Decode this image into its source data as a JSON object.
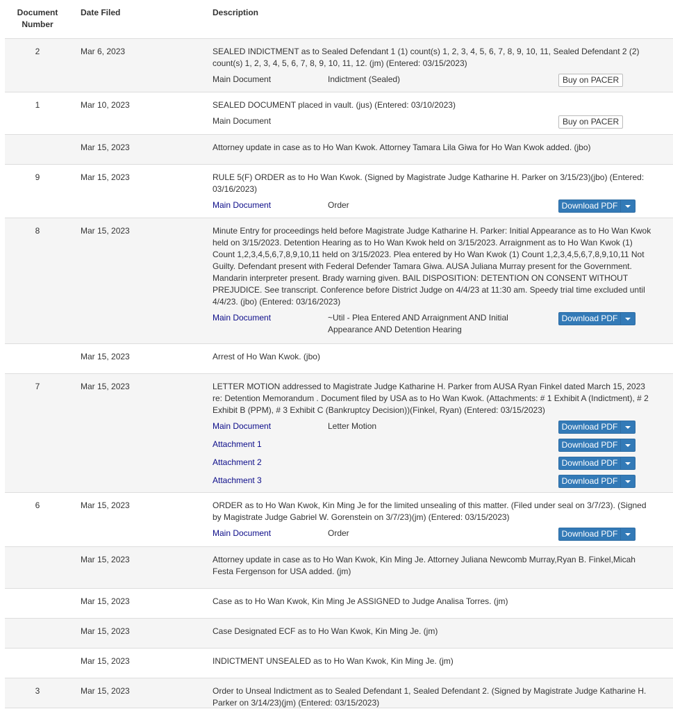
{
  "headers": {
    "number": "Document Number",
    "date": "Date Filed",
    "description": "Description"
  },
  "entries": [
    {
      "number": "2",
      "date": "Mar 6, 2023",
      "description": "SEALED INDICTMENT as to Sealed Defendant 1 (1) count(s) 1, 2, 3, 4, 5, 6, 7, 8, 9, 10, 11, Sealed Defendant 2 (2) count(s) 1, 2, 3, 4, 5, 6, 7, 8, 9, 10, 11, 12. (jm) (Entered: 03/15/2023)",
      "attachments": [
        {
          "label": "Main Document",
          "desc": "Indictment (Sealed)",
          "action": "Buy on PACER",
          "link": false
        }
      ]
    },
    {
      "number": "1",
      "date": "Mar 10, 2023",
      "description": "SEALED DOCUMENT placed in vault. (jus) (Entered: 03/10/2023)",
      "attachments": [
        {
          "label": "Main Document",
          "desc": "",
          "action": "Buy on PACER",
          "link": false
        }
      ]
    },
    {
      "number": "",
      "date": "Mar 15, 2023",
      "description": "Attorney update in case as to Ho Wan Kwok. Attorney Tamara Lila Giwa for Ho Wan Kwok added. (jbo)",
      "attachments": []
    },
    {
      "number": "9",
      "date": "Mar 15, 2023",
      "description": "RULE 5(F) ORDER as to Ho Wan Kwok. (Signed by Magistrate Judge Katharine H. Parker on 3/15/23)(jbo) (Entered: 03/16/2023)",
      "attachments": [
        {
          "label": "Main Document",
          "desc": "Order",
          "action": "Download PDF",
          "link": true
        }
      ]
    },
    {
      "number": "8",
      "date": "Mar 15, 2023",
      "description": "Minute Entry for proceedings held before Magistrate Judge Katharine H. Parker: Initial Appearance as to Ho Wan Kwok held on 3/15/2023. Detention Hearing as to Ho Wan Kwok held on 3/15/2023. Arraignment as to Ho Wan Kwok (1) Count 1,2,3,4,5,6,7,8,9,10,11 held on 3/15/2023. Plea entered by Ho Wan Kwok (1) Count 1,2,3,4,5,6,7,8,9,10,11 Not Guilty. Defendant present with Federal Defender Tamara Giwa. AUSA Juliana Murray present for the Government. Mandarin interpreter present. Brady warning given. BAIL DISPOSITION: DETENTION ON CONSENT WITHOUT PREJUDICE. See transcript. Conference before District Judge on 4/4/23 at 11:30 am. Speedy trial time excluded until 4/4/23. (jbo) (Entered: 03/16/2023)",
      "attachments": [
        {
          "label": "Main Document",
          "desc": "~Util - Plea Entered AND Arraignment AND Initial Appearance AND Detention Hearing",
          "action": "Download PDF",
          "link": true
        }
      ]
    },
    {
      "number": "",
      "date": "Mar 15, 2023",
      "description": "Arrest of Ho Wan Kwok. (jbo)",
      "attachments": []
    },
    {
      "number": "7",
      "date": "Mar 15, 2023",
      "description": "LETTER MOTION addressed to Magistrate Judge Katharine H. Parker from AUSA Ryan Finkel dated March 15, 2023 re: Detention Memorandum . Document filed by USA as to Ho Wan Kwok. (Attachments: # 1 Exhibit A (Indictment), # 2 Exhibit B (PPM), # 3 Exhibit C (Bankruptcy Decision))(Finkel, Ryan) (Entered: 03/15/2023)",
      "attachments": [
        {
          "label": "Main Document",
          "desc": "Letter Motion",
          "action": "Download PDF",
          "link": true
        },
        {
          "label": "Attachment 1",
          "desc": "",
          "action": "Download PDF",
          "link": true
        },
        {
          "label": "Attachment 2",
          "desc": "",
          "action": "Download PDF",
          "link": true
        },
        {
          "label": "Attachment 3",
          "desc": "",
          "action": "Download PDF",
          "link": true
        }
      ]
    },
    {
      "number": "6",
      "date": "Mar 15, 2023",
      "description": "ORDER as to Ho Wan Kwok, Kin Ming Je for the limited unsealing of this matter. (Filed under seal on 3/7/23). (Signed by Magistrate Judge Gabriel W. Gorenstein on 3/7/23)(jm) (Entered: 03/15/2023)",
      "attachments": [
        {
          "label": "Main Document",
          "desc": "Order",
          "action": "Download PDF",
          "link": true
        }
      ]
    },
    {
      "number": "",
      "date": "Mar 15, 2023",
      "description": "Attorney update in case as to Ho Wan Kwok, Kin Ming Je. Attorney Juliana Newcomb Murray,Ryan B. Finkel,Micah Festa Fergenson for USA added. (jm)",
      "attachments": []
    },
    {
      "number": "",
      "date": "Mar 15, 2023",
      "description": "Case as to Ho Wan Kwok, Kin Ming Je ASSIGNED to Judge Analisa Torres. (jm)",
      "attachments": []
    },
    {
      "number": "",
      "date": "Mar 15, 2023",
      "description": "Case Designated ECF as to Ho Wan Kwok, Kin Ming Je. (jm)",
      "attachments": []
    },
    {
      "number": "",
      "date": "Mar 15, 2023",
      "description": "INDICTMENT UNSEALED as to Ho Wan Kwok, Kin Ming Je. (jm)",
      "attachments": []
    },
    {
      "number": "3",
      "date": "Mar 15, 2023",
      "description": "Order to Unseal Indictment as to Sealed Defendant 1, Sealed Defendant 2. (Signed by Magistrate Judge Katharine H. Parker on 3/14/23)(jm) (Entered: 03/15/2023)",
      "attachments": []
    }
  ]
}
